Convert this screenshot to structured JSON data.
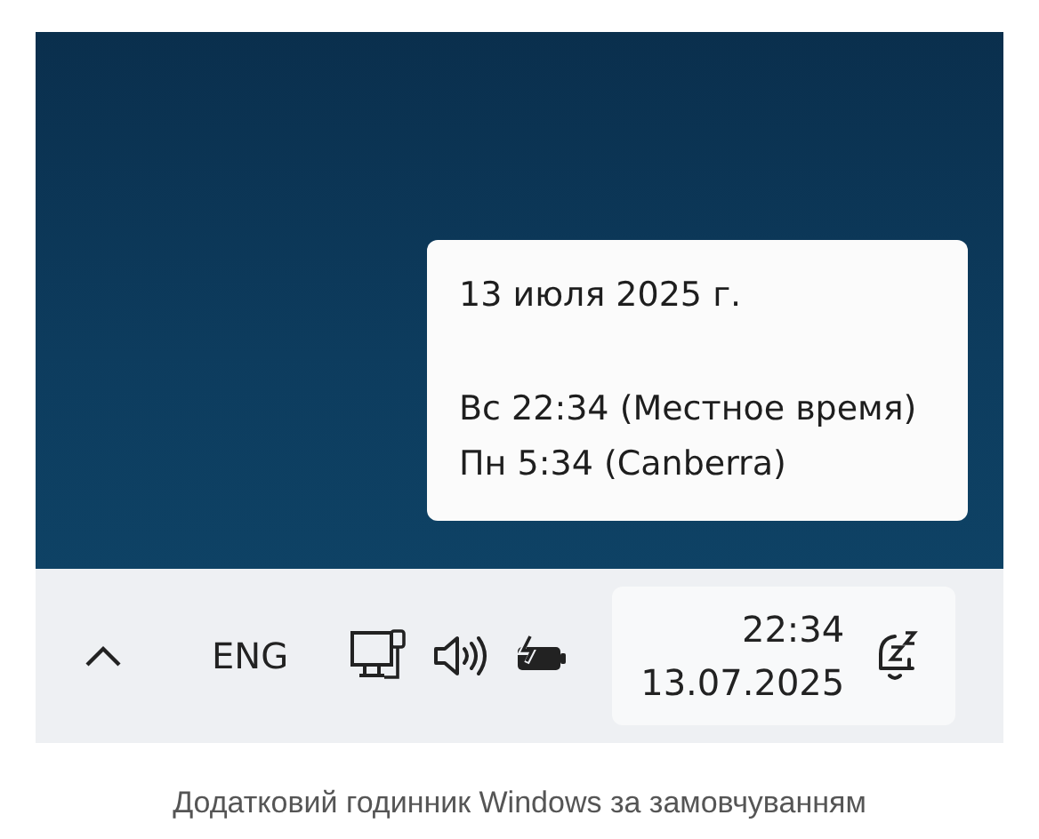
{
  "tooltip": {
    "date": "13 июля 2025 г.",
    "clocks": [
      "Вс 22:34 (Местное время)",
      "Пн 5:34 (Canberra)"
    ]
  },
  "taskbar": {
    "language": "ENG",
    "time": "22:34",
    "date": "13.07.2025"
  },
  "caption": "Додатковий годинник Windows за замовчуванням"
}
